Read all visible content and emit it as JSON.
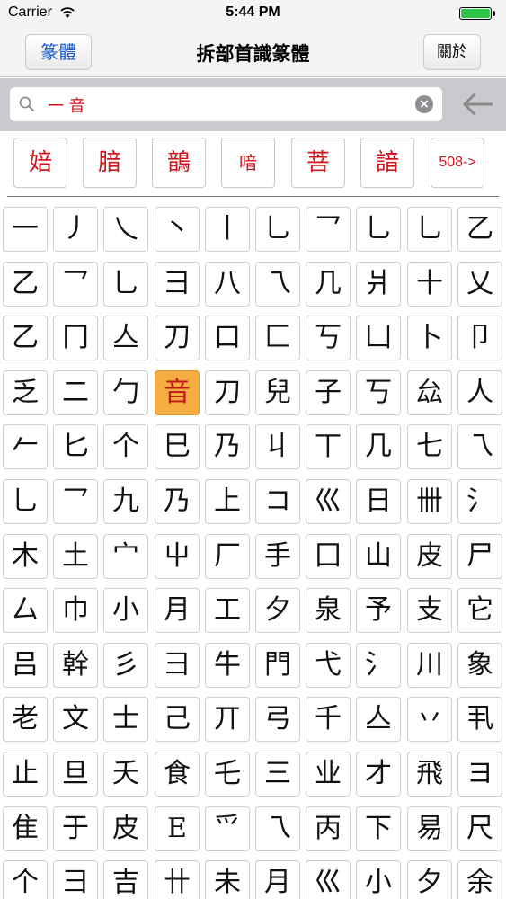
{
  "status_bar": {
    "carrier": "Carrier",
    "time": "5:44 PM",
    "battery_level": 1.0
  },
  "nav": {
    "title": "拆部首識篆體",
    "left_button": "篆體",
    "right_button": "關於"
  },
  "search": {
    "query": "一 音",
    "clear_icon": "clear-icon",
    "back_icon": "back-arrow-icon"
  },
  "results": {
    "items": [
      "婄",
      "腤",
      "鶕",
      "喑",
      "菩",
      "諳"
    ],
    "more_label": "508->"
  },
  "accent_colors": {
    "result_text": "#d0141c",
    "selected_cell": "#f4ad41",
    "nav_button_text": "#1a5bd6"
  },
  "grid": {
    "selected_index": 33,
    "cells": [
      "一",
      "丿",
      "乀",
      "丶",
      "丨",
      "乚",
      "乛",
      "乚",
      "乚",
      "乙",
      "乙",
      "乛",
      "乚",
      "彐",
      "八",
      "乁",
      "几",
      "爿",
      "十",
      "乂",
      "乙",
      "冂",
      "亼",
      "刀",
      "口",
      "匚",
      "丂",
      "凵",
      "卜",
      "卩",
      "乏",
      "二",
      "勹",
      "音",
      "刀",
      "兒",
      "子",
      "丂",
      "厽",
      "人",
      "𠂉",
      "匕",
      "个",
      "巳",
      "乃",
      "丩",
      "丅",
      "几",
      "七",
      "乁",
      "乚",
      "乛",
      "九",
      "乃",
      "上",
      "コ",
      "巛",
      "日",
      "卌",
      "氵",
      "木",
      "土",
      "宀",
      "屮",
      "厂",
      "手",
      "囗",
      "山",
      "皮",
      "尸",
      "厶",
      "巾",
      "小",
      "月",
      "工",
      "夕",
      "泉",
      "予",
      "支",
      "它",
      "吕",
      "幹",
      "彡",
      "彐",
      "牛",
      "門",
      "弋",
      "氵",
      "川",
      "象",
      "老",
      "文",
      "士",
      "己",
      "丌",
      "弓",
      "千",
      "亼",
      "丷",
      "丮",
      "止",
      "旦",
      "夭",
      "食",
      "乇",
      "三",
      "业",
      "才",
      "飛",
      "ヨ",
      "隹",
      "于",
      "皮",
      "E",
      "爫",
      "乁",
      "丙",
      "下",
      "易",
      "尺",
      "个",
      "彐",
      "吉",
      "卄",
      "未",
      "月",
      "巛",
      "小",
      "夕",
      "余"
    ]
  }
}
